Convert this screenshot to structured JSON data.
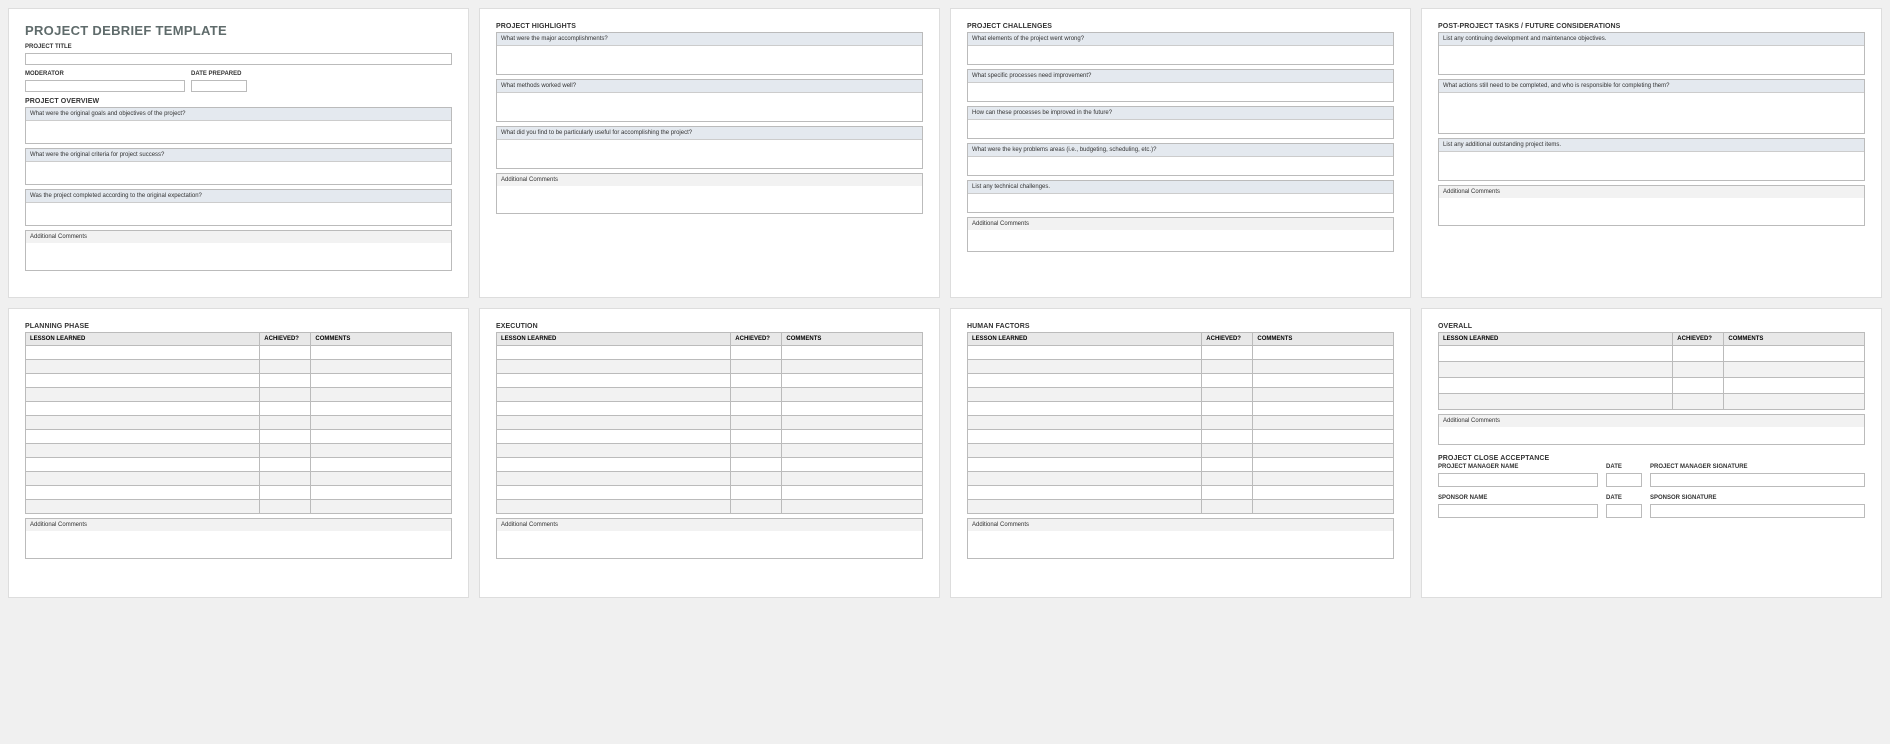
{
  "page1": {
    "title": "PROJECT DEBRIEF TEMPLATE",
    "fields": {
      "project_title": "PROJECT TITLE",
      "moderator": "MODERATOR",
      "date_prepared": "DATE PREPARED"
    },
    "overview": {
      "title": "PROJECT OVERVIEW",
      "q1": "What were the original goals and objectives of the project?",
      "q2": "What were the original criteria for project success?",
      "q3": "Was the project completed according to the original expectation?",
      "addl": "Additional Comments"
    }
  },
  "page2": {
    "title": "PROJECT HIGHLIGHTS",
    "q1": "What were the major accomplishments?",
    "q2": "What methods worked well?",
    "q3": "What did you find to be particularly useful for accomplishing the project?",
    "addl": "Additional Comments"
  },
  "page3": {
    "title": "PROJECT CHALLENGES",
    "q1": "What elements of the project went wrong?",
    "q2": "What specific processes need improvement?",
    "q3": "How can these processes be improved in the future?",
    "q4": "What were the key problems areas (i.e., budgeting, scheduling, etc.)?",
    "q5": "List any technical challenges.",
    "addl": "Additional Comments"
  },
  "page4": {
    "title": "POST-PROJECT TASKS / FUTURE CONSIDERATIONS",
    "q1": "List any continuing development and maintenance objectives.",
    "q2": "What actions still need to be completed, and who is responsible for completing them?",
    "q3": "List any additional outstanding project items.",
    "addl": "Additional Comments"
  },
  "page5": {
    "title": "PLANNING PHASE",
    "h_lesson": "LESSON LEARNED",
    "h_ach": "ACHIEVED?",
    "h_com": "COMMENTS",
    "addl": "Additional Comments"
  },
  "page6": {
    "title": "EXECUTION",
    "h_lesson": "LESSON LEARNED",
    "h_ach": "ACHIEVED?",
    "h_com": "COMMENTS",
    "addl": "Additional Comments"
  },
  "page7": {
    "title": "HUMAN FACTORS",
    "h_lesson": "LESSON LEARNED",
    "h_ach": "ACHIEVED?",
    "h_com": "COMMENTS",
    "addl": "Additional Comments"
  },
  "page8": {
    "overall_title": "OVERALL",
    "h_lesson": "LESSON LEARNED",
    "h_ach": "ACHIEVED?",
    "h_com": "COMMENTS",
    "addl": "Additional Comments",
    "close_title": "PROJECT CLOSE ACCEPTANCE",
    "pm_name": "PROJECT MANAGER NAME",
    "date": "DATE",
    "pm_sig": "PROJECT MANAGER SIGNATURE",
    "sp_name": "SPONSOR NAME",
    "sp_sig": "SPONSOR SIGNATURE"
  }
}
